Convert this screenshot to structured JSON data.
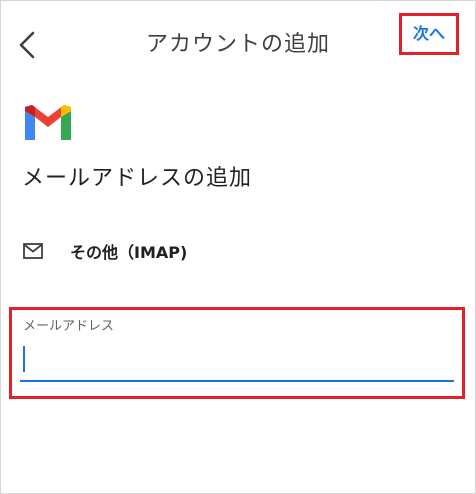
{
  "header": {
    "back_icon": "chevron-left-icon",
    "title": "アカウントの追加",
    "next_label": "次へ"
  },
  "logo": {
    "icon": "gmail-logo",
    "colors": {
      "blue": "#4285f4",
      "red": "#ea4335",
      "green": "#34a853",
      "yellow": "#fbbc04",
      "dark_red": "#c5221f"
    }
  },
  "main": {
    "heading": "メールアドレスの追加",
    "account_type": {
      "icon": "mail-icon",
      "label": "その他（IMAP)"
    },
    "email_field": {
      "label": "メールアドレス",
      "value": "",
      "placeholder": ""
    }
  },
  "colors": {
    "accent": "#1a73e8",
    "highlight": "#e3212a",
    "text": "#202124"
  }
}
